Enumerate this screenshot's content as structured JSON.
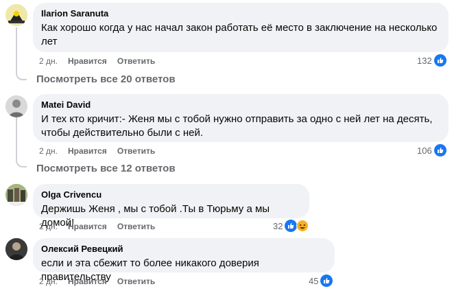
{
  "comments": [
    {
      "author": "Ilarion Saranuta",
      "text": "Как хорошо когда у нас начал закон работать её место в заключение на несколько лет",
      "time": "2 дн.",
      "like_label": "Нравится",
      "reply_label": "Ответить",
      "reactions_count": "132",
      "view_replies": "Посмотреть все 20 ответов"
    },
    {
      "author": "Matei David",
      "text": "И тех кто кричит:- Женя мы с тобой нужно отправить за одно с ней лет на десять, чтобы действительно были с ней.",
      "time": "2 дн.",
      "like_label": "Нравится",
      "reply_label": "Ответить",
      "reactions_count": "106",
      "view_replies": "Посмотреть все 12 ответов"
    },
    {
      "author": "Olga Crivencu",
      "text": "Держишь Женя , мы с тобой .Ты в Тюрьму а мы домой!",
      "time": "2 дн.",
      "like_label": "Нравится",
      "reply_label": "Ответить",
      "reactions_count": "32"
    },
    {
      "author": "Олексий Ревецкий",
      "text": "если и эта сбежит то более никакого доверия правительству",
      "time": "2 дн.",
      "like_label": "Нравится",
      "reply_label": "Ответить",
      "reactions_count": "45"
    }
  ],
  "icons": {
    "like": "like-icon",
    "haha": "haha-icon"
  },
  "colors": {
    "bubble": "#f0f2f5",
    "like_blue": "#1877f2",
    "muted_text": "#65676b"
  }
}
